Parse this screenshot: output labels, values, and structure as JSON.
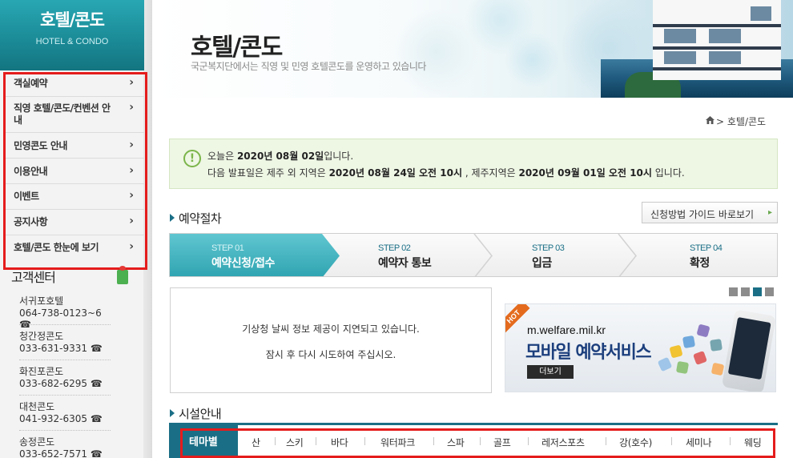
{
  "sidebar": {
    "title": "호텔/콘도",
    "subtitle": "HOTEL & CONDO",
    "menu": [
      {
        "label": "객실예약"
      },
      {
        "label": "직영 호텔/콘도/컨벤션 안내"
      },
      {
        "label": "민영콘도 안내"
      },
      {
        "label": "이용안내"
      },
      {
        "label": "이벤트"
      },
      {
        "label": "공지사항"
      },
      {
        "label": "호텔/콘도 한눈에 보기"
      }
    ],
    "chevron": "›",
    "customer_center": {
      "title": "고객센터",
      "entries": [
        {
          "name": "서귀포호텔",
          "phone": "064-738-0123~6 ☎"
        },
        {
          "name": "청간정콘도",
          "phone": "033-631-9331 ☎"
        },
        {
          "name": "화진포콘도",
          "phone": "033-682-6295 ☎"
        },
        {
          "name": "대천콘도",
          "phone": "041-932-6305 ☎"
        },
        {
          "name": "송정콘도",
          "phone": "033-652-7571 ☎"
        }
      ]
    }
  },
  "header": {
    "title": "호텔/콘도",
    "subtitle": "국군복지단에서는 직영 및 민영 호텔콘도를 운영하고 있습니다"
  },
  "breadcrumb": {
    "current": "호텔/콘도"
  },
  "notice": {
    "icon": "!",
    "today_prefix": "오늘은 ",
    "today_date": "2020년 08월 02일",
    "today_suffix": "입니다.",
    "next_prefix": "다음 발표일은 제주 외 지역은 ",
    "next_date_other": "2020년 08월 24일 오전 10시",
    "next_mid": " , 제주지역은 ",
    "next_date_jeju": "2020년 09월 01일 오전 10시",
    "next_suffix": " 입니다."
  },
  "procedure": {
    "title": "예약절차",
    "guide_button": "신청방법 가이드 바로보기",
    "guide_arrow": "▸",
    "steps": [
      {
        "num": "STEP 01",
        "label": "예약신청/접수",
        "active": true
      },
      {
        "num": "STEP 02",
        "label": "예약자 통보",
        "active": false
      },
      {
        "num": "STEP 03",
        "label": "입금",
        "active": false
      },
      {
        "num": "STEP 04",
        "label": "확정",
        "active": false
      }
    ]
  },
  "weather": {
    "line1": "기상청 날씨 정보 제공이 지연되고 있습니다.",
    "line2": "잠시 후 다시 시도하여 주십시오."
  },
  "mobile_ad": {
    "badge": "HOT",
    "url": "m.welfare.mil.kr",
    "headline": "모바일 예약서비스",
    "more_button": "더보기",
    "active_dot": 3
  },
  "facilities": {
    "title": "시설안내",
    "active_tab": "테마별",
    "tabs": [
      "산",
      "스키",
      "바다",
      "워터파크",
      "스파",
      "골프",
      "레저스포츠",
      "강(호수)",
      "세미나",
      "웨딩"
    ]
  },
  "colors": {
    "teal": "#1a6f86",
    "highlight_red": "#e51c1c",
    "notice_green": "#7bb54a"
  }
}
